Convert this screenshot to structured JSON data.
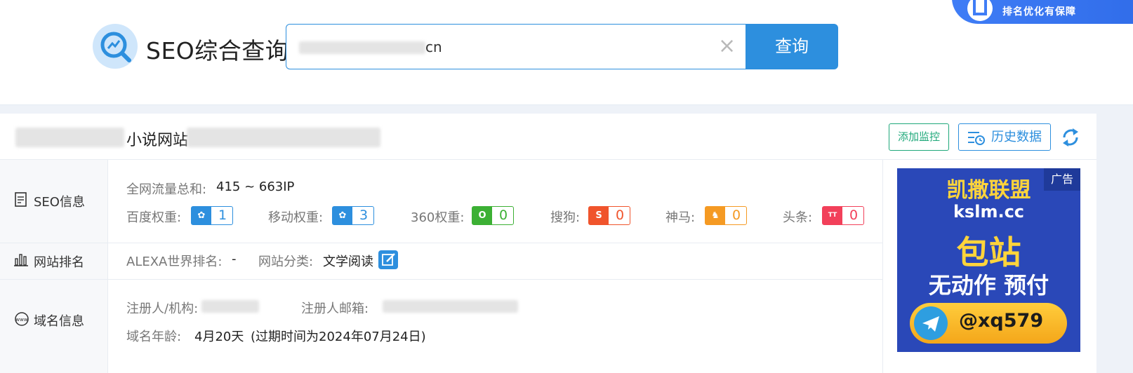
{
  "header": {
    "logo_text": "SEO综合查询",
    "search_value": "cn",
    "search_button": "查询",
    "promo_text": "排名优化有保障"
  },
  "site": {
    "title_visible": "小说网站",
    "add_monitor_label": "添加监控",
    "history_label": "历史数据"
  },
  "seo_info": {
    "section_label": "SEO信息",
    "traffic_label": "全网流量总和:",
    "traffic_value": "415 ~ 663IP",
    "weights": [
      {
        "label": "百度权重:",
        "value": "1",
        "icon": "baidu-paw-icon",
        "color": "#2d8fde"
      },
      {
        "label": "移动权重:",
        "value": "3",
        "icon": "baidu-paw-icon",
        "color": "#2d8fde"
      },
      {
        "label": "360权重:",
        "value": "0",
        "icon": "360-icon",
        "color": "#3cb034"
      },
      {
        "label": "搜狗:",
        "value": "0",
        "icon": "sogou-icon",
        "color": "#f0542c"
      },
      {
        "label": "神马:",
        "value": "0",
        "icon": "shenma-icon",
        "color": "#f59a23"
      },
      {
        "label": "头条:",
        "value": "0",
        "icon": "toutiao-icon",
        "color": "#f2405a"
      }
    ]
  },
  "ranking": {
    "section_label": "网站排名",
    "alexa_label": "ALEXA世界排名:",
    "alexa_value": "-",
    "category_label": "网站分类:",
    "category_value": "文学阅读"
  },
  "domain": {
    "section_label": "域名信息",
    "registrant_label": "注册人/机构:",
    "email_label": "注册人邮箱:",
    "age_label": "域名年龄:",
    "age_value": "4月20天",
    "expire_text": "(过期时间为2024年07月24日)"
  },
  "ad": {
    "tag": "广告",
    "line1": "凯撒联盟",
    "line2": "kslm.cc",
    "line3": "包站",
    "line4": "无动作 预付",
    "handle": "@xq579"
  }
}
